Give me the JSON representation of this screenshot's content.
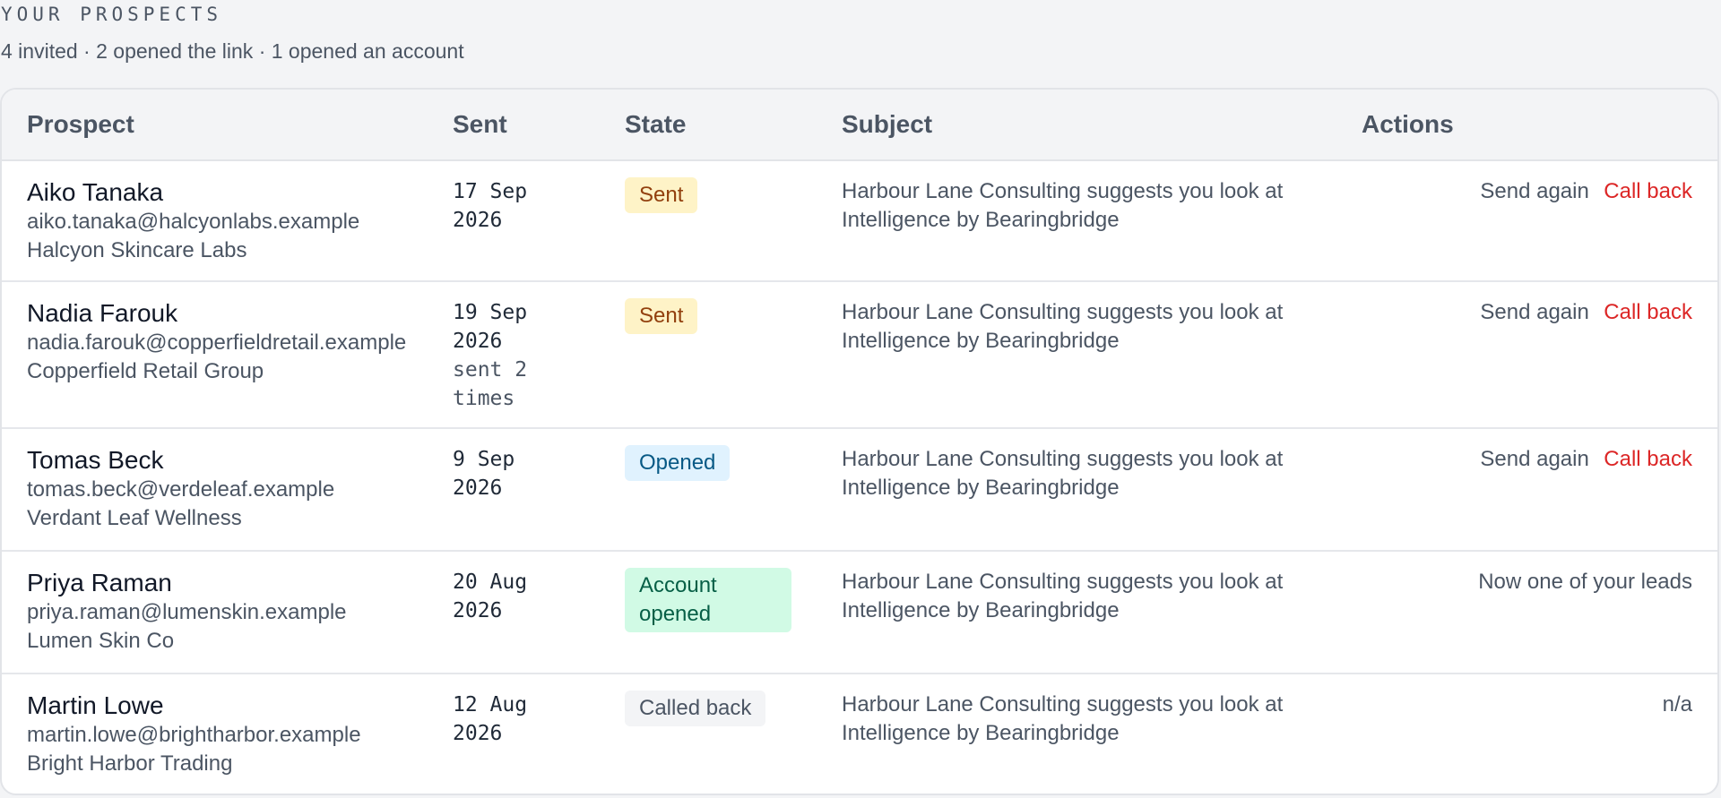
{
  "header": {
    "section_label": "YOUR PROSPECTS",
    "summary": "4 invited · 2 opened the link · 1 opened an account"
  },
  "table": {
    "columns": {
      "prospect": "Prospect",
      "sent": "Sent",
      "state": "State",
      "subject": "Subject",
      "actions": "Actions"
    },
    "rows": [
      {
        "name": "Aiko Tanaka",
        "email": "aiko.tanaka@halcyonlabs.example",
        "company": "Halcyon Skincare Labs",
        "sent_date": "17 Sep\n2026",
        "sent_note": "",
        "state": "Sent",
        "subject": "Harbour Lane Consulting suggests you look at Intelligence by Bearingbridge",
        "action_send": "Send again",
        "action_call": "Call back",
        "action_static": ""
      },
      {
        "name": "Nadia Farouk",
        "email": "nadia.farouk@copperfieldretail.example",
        "company": "Copperfield Retail Group",
        "sent_date": "19 Sep\n2026",
        "sent_note": "sent 2\ntimes",
        "state": "Sent",
        "subject": "Harbour Lane Consulting suggests you look at Intelligence by Bearingbridge",
        "action_send": "Send again",
        "action_call": "Call back",
        "action_static": ""
      },
      {
        "name": "Tomas Beck",
        "email": "tomas.beck@verdeleaf.example",
        "company": "Verdant Leaf Wellness",
        "sent_date": "9 Sep\n2026",
        "sent_note": "",
        "state": "Opened",
        "subject": "Harbour Lane Consulting suggests you look at Intelligence by Bearingbridge",
        "action_send": "Send again",
        "action_call": "Call back",
        "action_static": ""
      },
      {
        "name": "Priya Raman",
        "email": "priya.raman@lumenskin.example",
        "company": "Lumen Skin Co",
        "sent_date": "20 Aug\n2026",
        "sent_note": "",
        "state": "Account opened",
        "subject": "Harbour Lane Consulting suggests you look at Intelligence by Bearingbridge",
        "action_send": "",
        "action_call": "",
        "action_static": "Now one of your leads"
      },
      {
        "name": "Martin Lowe",
        "email": "martin.lowe@brightharbor.example",
        "company": "Bright Harbor Trading",
        "sent_date": "12 Aug\n2026",
        "sent_note": "",
        "state": "Called back",
        "subject": "Harbour Lane Consulting suggests you look at Intelligence by Bearingbridge",
        "action_send": "",
        "action_call": "",
        "action_static": "n/a"
      }
    ]
  },
  "colors": {
    "page_bg": "#f3f4f6",
    "call_back": "#dc2626",
    "badge_sent_bg": "#fef3c7",
    "badge_opened_bg": "#e0f2fe",
    "badge_account_bg": "#d1fae5",
    "badge_called_bg": "#f3f4f6"
  }
}
